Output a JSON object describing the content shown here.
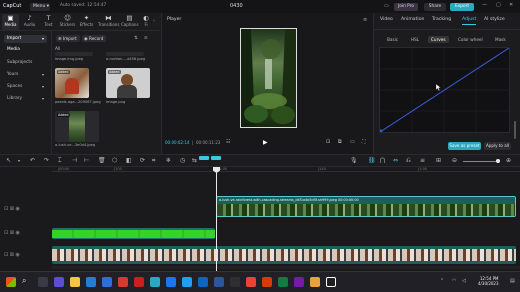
{
  "titlebar": {
    "logo": "CapCut",
    "menu": "Menu",
    "autosave": "Auto saved: 12:54:47",
    "title": "0430",
    "join_pro": "Join Pro",
    "share": "Share",
    "export": "Export"
  },
  "toolbar": {
    "items": [
      {
        "label": "Media",
        "icon": "media-icon"
      },
      {
        "label": "Audio",
        "icon": "audio-icon"
      },
      {
        "label": "Text",
        "icon": "text-icon"
      },
      {
        "label": "Stickers",
        "icon": "stickers-icon"
      },
      {
        "label": "Effects",
        "icon": "effects-icon"
      },
      {
        "label": "Transitions",
        "icon": "transitions-icon"
      },
      {
        "label": "Captions",
        "icon": "captions-icon"
      },
      {
        "label": "Fi",
        "icon": "filters-icon"
      }
    ]
  },
  "leftnav": {
    "import": "Import",
    "media": "Media",
    "subprojects": "Subprojects",
    "yours": "Yours",
    "spaces": "Spaces",
    "library": "Library"
  },
  "media": {
    "import_button": "Import",
    "record_button": "Record",
    "all_label": "All",
    "files": [
      {
        "name": "Image.img.jpeg",
        "added": false
      },
      {
        "name": "a-ruetion-...d456.jpeg",
        "added": false
      },
      {
        "name": "pexels-oga...209067.jpeg",
        "added": true
      },
      {
        "name": "Image.png",
        "added": true
      },
      {
        "name": "a-lush-ve...3e0d4.jpeg",
        "added": true
      }
    ],
    "added_badge": "Added"
  },
  "player": {
    "title": "Player",
    "current_time": "00:00:02:14",
    "total_time": "00:00:11:23"
  },
  "rightpanel": {
    "tabs": [
      "Video",
      "Animation",
      "Tracking",
      "Adjust",
      "AI stylize"
    ],
    "active_tab": "Adjust",
    "subtabs": [
      "Basic",
      "HSL",
      "Curves",
      "Color wheel",
      "Mask"
    ],
    "active_subtab": "Curves",
    "save_preset": "Save as preset",
    "apply_all": "Apply to all"
  },
  "timeline": {
    "ruler_marks": [
      "|00:00",
      "|100",
      "|1:00",
      "|140",
      "|1:00"
    ],
    "clip_label": "a-lush-ve-rainforest-with-cascading-streams_d4f1a4b5d5f-sh999.jpeg  00:00:00:00"
  },
  "taskbar": {
    "time": "12:54 PM",
    "date": "4/30/2023"
  },
  "colors": {
    "accent": "#2aa9c4",
    "green_clip": "#33d32a",
    "teal_track": "#1f6f6a"
  }
}
